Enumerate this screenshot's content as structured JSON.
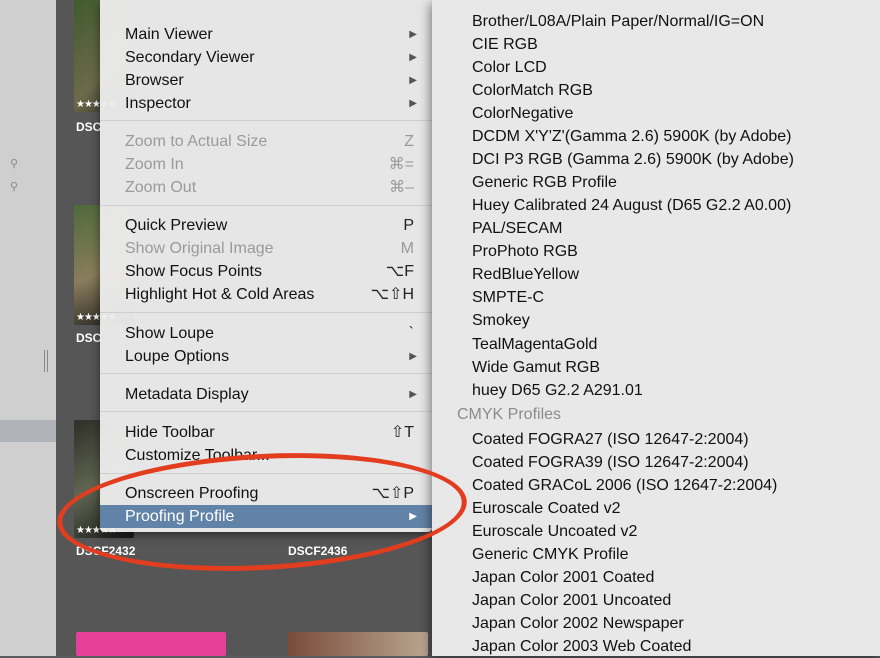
{
  "sidebar": {
    "icons": [
      "magnifier-icon",
      "magnifier-icon"
    ]
  },
  "thumbnails": {
    "labels": [
      "DSC",
      "DSC",
      "DSC",
      "DSCF2432",
      "DSCF2436"
    ],
    "stars": "★★★★★"
  },
  "menu": {
    "items": [
      {
        "label": "Main Viewer",
        "submenu": true
      },
      {
        "label": "Secondary Viewer",
        "submenu": true
      },
      {
        "label": "Browser",
        "submenu": true
      },
      {
        "label": "Inspector",
        "submenu": true
      },
      {
        "label": "Zoom to Actual Size",
        "shortcut": "Z",
        "disabled": true
      },
      {
        "label": "Zoom In",
        "shortcut": "⌘=",
        "disabled": true
      },
      {
        "label": "Zoom Out",
        "shortcut": "⌘–",
        "disabled": true
      },
      {
        "label": "Quick Preview",
        "shortcut": "P"
      },
      {
        "label": "Show Original Image",
        "shortcut": "M",
        "disabled": true
      },
      {
        "label": "Show Focus Points",
        "shortcut": "⌥F"
      },
      {
        "label": "Highlight Hot & Cold Areas",
        "shortcut": "⌥⇧H"
      },
      {
        "label": "Show Loupe",
        "shortcut": "`"
      },
      {
        "label": "Loupe Options",
        "submenu": true
      },
      {
        "label": "Metadata Display",
        "submenu": true
      },
      {
        "label": "Hide Toolbar",
        "shortcut": "⇧T"
      },
      {
        "label": "Customize Toolbar..."
      },
      {
        "label": "Onscreen Proofing",
        "shortcut": "⌥⇧P"
      },
      {
        "label": "Proofing Profile",
        "submenu": true,
        "selected": true
      }
    ]
  },
  "submenu": {
    "rgb_profiles": [
      "Brother/L08A/Plain Paper/Normal/IG=ON",
      "CIE RGB",
      "Color LCD",
      "ColorMatch RGB",
      "ColorNegative",
      "DCDM X'Y'Z'(Gamma 2.6) 5900K (by Adobe)",
      "DCI P3 RGB (Gamma 2.6) 5900K (by Adobe)",
      "Generic RGB Profile",
      "Huey Calibrated 24 August (D65 G2.2 A0.00)",
      "PAL/SECAM",
      "ProPhoto RGB",
      "RedBlueYellow",
      "SMPTE-C",
      "Smokey",
      "TealMagentaGold",
      "Wide Gamut RGB",
      "huey D65 G2.2 A291.01"
    ],
    "cmyk_header": "CMYK Profiles",
    "cmyk_profiles": [
      "Coated FOGRA27 (ISO 12647-2:2004)",
      "Coated FOGRA39 (ISO 12647-2:2004)",
      "Coated GRACoL 2006 (ISO 12647-2:2004)",
      "Euroscale Coated v2",
      "Euroscale Uncoated v2",
      "Generic CMYK Profile",
      "Japan Color 2001 Coated",
      "Japan Color 2001 Uncoated",
      "Japan Color 2002 Newspaper",
      "Japan Color 2003 Web Coated"
    ]
  },
  "colors": {
    "highlight": "#6283a8",
    "annotation": "#e23d1f"
  }
}
